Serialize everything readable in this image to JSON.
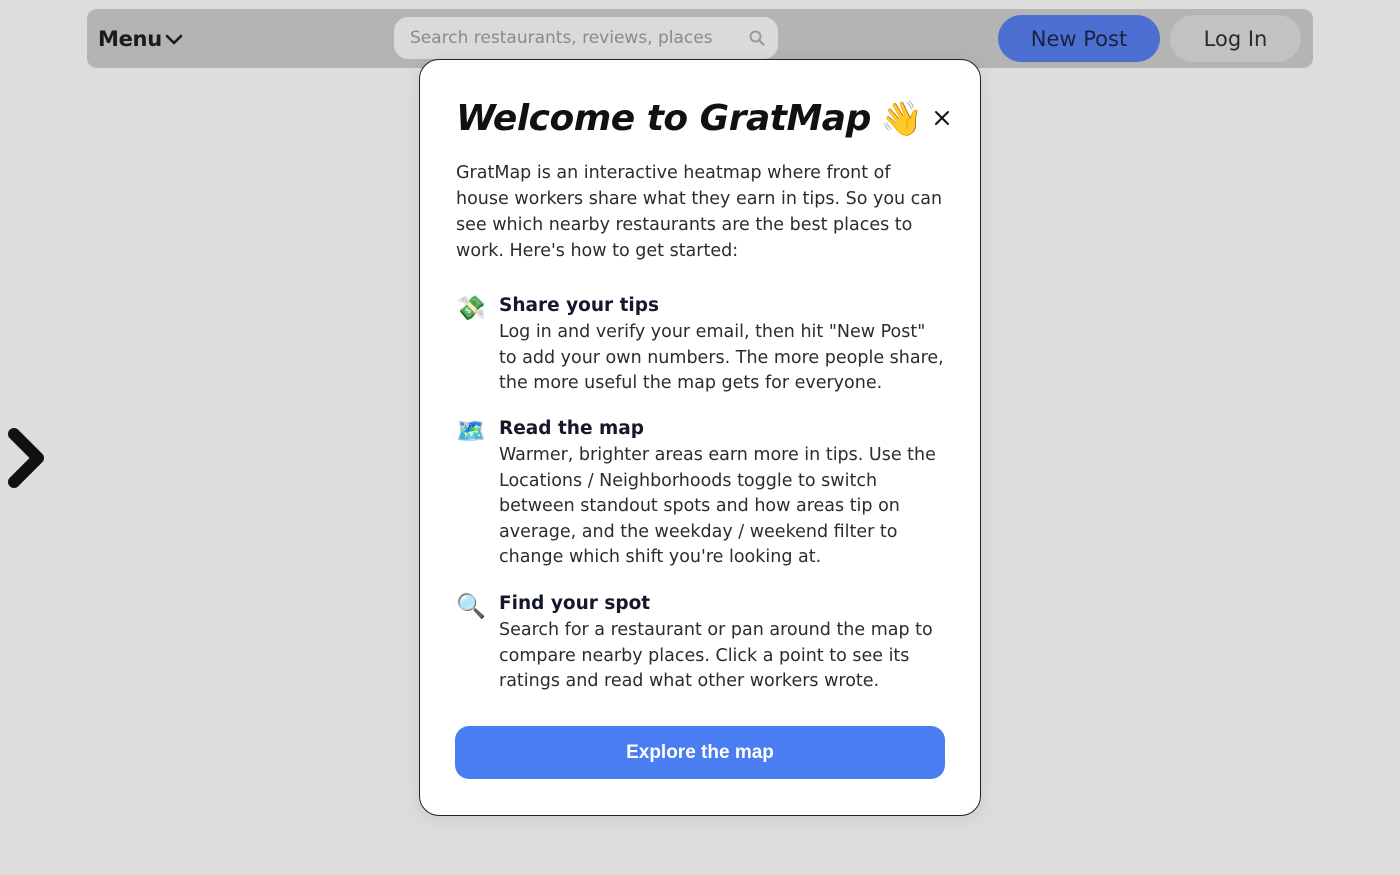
{
  "header": {
    "menu_label": "Menu",
    "search_placeholder": "Search restaurants, reviews, places",
    "new_post_label": "New Post",
    "login_label": "Log In"
  },
  "modal": {
    "title": "Welcome to GratMap",
    "title_emoji": "👋",
    "intro": "GratMap is an interactive heatmap where front of house workers share what they earn in tips. So you can see which nearby restaurants are the best places to work. Here's how to get started:",
    "steps": [
      {
        "icon": "money-with-wings-icon",
        "emoji": "💸",
        "heading": "Share your tips",
        "body": "Log in and verify your email, then hit \"New Post\" to add your own numbers. The more people share, the more useful the map gets for everyone."
      },
      {
        "icon": "world-map-icon",
        "emoji": "🗺️",
        "heading": "Read the map",
        "body": "Warmer, brighter areas earn more in tips. Use the Locations / Neighborhoods toggle to switch between standout spots and how areas tip on average, and the weekday / weekend filter to change which shift you're looking at."
      },
      {
        "icon": "magnifying-glass-icon",
        "emoji": "🔍",
        "heading": "Find your spot",
        "body": "Search for a restaurant or pan around the map to compare nearby places. Click a point to see its ratings and read what other workers wrote."
      }
    ],
    "cta_label": "Explore the map"
  },
  "colors": {
    "accent": "#4a7df2",
    "new_post_dimmed": "#4d6fd1",
    "backdrop": "#dddddd"
  }
}
